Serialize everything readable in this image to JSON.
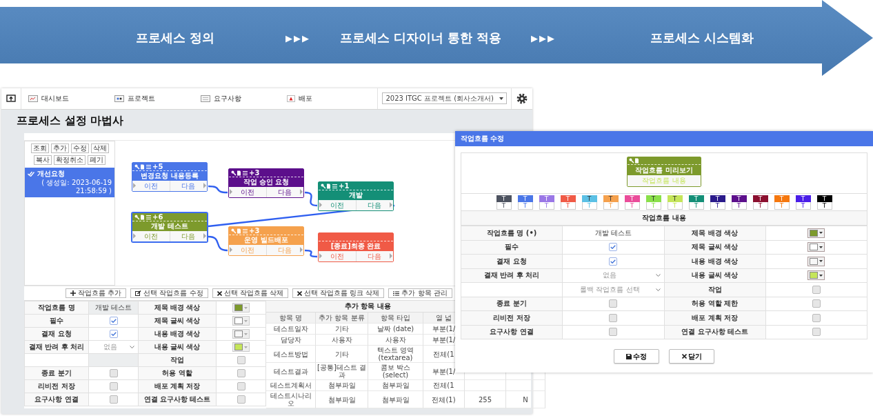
{
  "banner": {
    "items": [
      {
        "kind": "step",
        "text": "프로세스 정의"
      },
      {
        "kind": "separator",
        "text": "▶▶▶"
      },
      {
        "kind": "step",
        "text": "프로세스 디자이너 통한 적용"
      },
      {
        "kind": "separator",
        "text": "▶▶▶"
      },
      {
        "kind": "step",
        "text": "프로세스 시스템화"
      }
    ]
  },
  "app": {
    "nav": [
      {
        "label": "대시보드"
      },
      {
        "label": "프로젝트"
      },
      {
        "label": "요구사항"
      },
      {
        "label": "배포"
      }
    ],
    "project_select": {
      "value": "2023 ITGC 프로젝트 (회사소개서)"
    },
    "title": "프로세스 설정 마법사",
    "list_buttons": [
      "조회",
      "추가",
      "수정",
      "삭제",
      "복사",
      "확정취소",
      "폐기"
    ],
    "process_list": [
      {
        "label": "개선요청",
        "created": "( 생성일: 2023-06-19 21:58:59 )",
        "selected": true
      }
    ],
    "workflow_nodes": [
      {
        "title": "변경요청 내용등록",
        "badge": "+5",
        "color": "#4a76e8",
        "selected": false,
        "prev": "이전",
        "next": "다음"
      },
      {
        "title": "작업 승인 요청",
        "badge": "+3",
        "color": "#5c0f8b",
        "selected": false,
        "prev": "이전",
        "next": "다음"
      },
      {
        "title": "개발",
        "badge": "+1",
        "color": "#148f77",
        "selected": false,
        "prev": "이전",
        "next": "다음"
      },
      {
        "title": "개발 테스트",
        "badge": "+6",
        "color": "#7d9a2c",
        "selected": true,
        "prev": "이전",
        "next": "다음"
      },
      {
        "title": "운영 빌드배포",
        "badge": "+3",
        "color": "#f5a14d",
        "selected": false,
        "prev": "이전",
        "next": "다음"
      },
      {
        "title": "[종료]최종 완료",
        "color": "#f05a46",
        "selected": false,
        "prev": "이전",
        "next": "다음"
      }
    ],
    "actions": [
      {
        "label": "작업흐름 추가"
      },
      {
        "label": "선택 작업흐름 수정"
      },
      {
        "label": "선택 작업흐름 삭제"
      },
      {
        "label": "선택 작업흐름 링크 삭제"
      },
      {
        "label": "추가 항목 관리"
      }
    ],
    "properties": [
      [
        {
          "kind": "label",
          "text": "작업흐름 명"
        },
        {
          "kind": "text",
          "text": "개발 테스트"
        },
        {
          "kind": "label",
          "text": "제목 배경 색상"
        },
        {
          "kind": "color",
          "color": "#7d9a2c"
        }
      ],
      [
        {
          "kind": "label",
          "text": "필수"
        },
        {
          "kind": "check",
          "checked": true
        },
        {
          "kind": "label",
          "text": "제목 글씨 색상"
        },
        {
          "kind": "color",
          "color": "#ffffff"
        }
      ],
      [
        {
          "kind": "label",
          "text": "결재 요청"
        },
        {
          "kind": "check",
          "checked": true
        },
        {
          "kind": "label",
          "text": "내용 배경 색상"
        },
        {
          "kind": "color",
          "color": "#f7f7f7"
        }
      ],
      [
        {
          "kind": "label",
          "text": "결재 반려 후 처리"
        },
        {
          "kind": "select",
          "value": "없음"
        },
        {
          "kind": "label",
          "text": "내용 글씨 색상"
        },
        {
          "kind": "color",
          "color": "#c5e55a"
        }
      ],
      [
        {
          "kind": "blank"
        },
        {
          "kind": "blank-field"
        },
        {
          "kind": "label",
          "text": "작업"
        },
        {
          "kind": "check",
          "checked": false
        }
      ],
      [
        {
          "kind": "label",
          "text": "종료 분기"
        },
        {
          "kind": "check",
          "checked": false
        },
        {
          "kind": "label",
          "text": "허용 역할"
        },
        {
          "kind": "check",
          "checked": false
        }
      ],
      [
        {
          "kind": "label",
          "text": "리비전 저장"
        },
        {
          "kind": "check",
          "checked": false
        },
        {
          "kind": "label",
          "text": "배포 계획 저장"
        },
        {
          "kind": "check",
          "checked": false
        }
      ],
      [
        {
          "kind": "label",
          "text": "요구사항 연결"
        },
        {
          "kind": "check",
          "checked": false
        },
        {
          "kind": "label",
          "text": "연결 요구사항 테스트"
        },
        {
          "kind": "check",
          "checked": false
        }
      ]
    ],
    "extra_items": {
      "title": "추가 항목 내용",
      "columns": [
        "항목 명",
        "추가 항목 분류",
        "항목 타입",
        "열 넓"
      ],
      "rows": [
        [
          "테스트일자",
          "기타",
          "날짜 (date)",
          "부분(1/"
        ],
        [
          "담당자",
          "사용자",
          "사용자",
          "부분(1/"
        ],
        [
          "테스트방법",
          "기타",
          "텍스트 영역 (textarea)",
          "전체(1"
        ],
        [
          "테스트결과",
          "[공통]테스트 결과",
          "콤보 박스(select)",
          "부분(1/"
        ],
        [
          "테스트계획서",
          "첨부파일",
          "첨부파일",
          "전체(1"
        ],
        [
          "테스트시나리오",
          "첨부파일",
          "첨부파일",
          "전체(1)",
          "255",
          "N"
        ]
      ]
    }
  },
  "dialog": {
    "title": "작업흐름 수정",
    "preview": {
      "title": "작업흐름 미리보기",
      "content": "작업흐름 내용"
    },
    "palette": [
      {
        "color": "#4d5360",
        "top": "T",
        "bottom": "T"
      },
      {
        "color": "#4a76e8",
        "top": "T",
        "bottom": "T"
      },
      {
        "color": "#9a77e6",
        "top": "T",
        "bottom": "T"
      },
      {
        "color": "#f05a46",
        "top": "T",
        "bottom": "T"
      },
      {
        "color": "#5bc0e5",
        "top": "T",
        "bottom": "T"
      },
      {
        "color": "#f5a14d",
        "top": "T",
        "bottom": "T"
      },
      {
        "color": "#ea4c9a",
        "top": "T",
        "bottom": "T"
      },
      {
        "color": "#8ae04a",
        "top": "T",
        "bottom": "T"
      },
      {
        "color": "#c5e55a",
        "top": "T",
        "bottom": "T"
      },
      {
        "color": "#148f77",
        "top": "T",
        "bottom": "T"
      },
      {
        "color": "#2a1a8a",
        "top": "T",
        "bottom": "T"
      },
      {
        "color": "#5c0f8b",
        "top": "T",
        "bottom": "T"
      },
      {
        "color": "#8b0f2f",
        "top": "T",
        "bottom": "T"
      },
      {
        "color": "#f5770e",
        "top": "T",
        "bottom": "T"
      },
      {
        "color": "#4a1ee8",
        "top": "T",
        "bottom": "T"
      },
      {
        "color": "#000000",
        "top": "T",
        "bottom": "T"
      }
    ],
    "section": "작업흐름 내용",
    "properties": [
      [
        {
          "kind": "label",
          "text": "작업흐름 명 (•)"
        },
        {
          "kind": "text",
          "text": "개발 테스트"
        },
        {
          "kind": "label",
          "text": "제목 배경 색상"
        },
        {
          "kind": "color",
          "color": "#7d9a2c"
        }
      ],
      [
        {
          "kind": "label",
          "text": "필수"
        },
        {
          "kind": "check",
          "checked": true
        },
        {
          "kind": "label",
          "text": "제목 글씨 색상"
        },
        {
          "kind": "color",
          "color": "#ffffff"
        }
      ],
      [
        {
          "kind": "label",
          "text": "결재 요청"
        },
        {
          "kind": "check",
          "checked": true
        },
        {
          "kind": "label",
          "text": "내용 배경 색상"
        },
        {
          "kind": "color",
          "color": "#f7f7f7"
        }
      ],
      [
        {
          "kind": "label",
          "text": "결재 반려 후 처리"
        },
        {
          "kind": "select",
          "value": "없음"
        },
        {
          "kind": "label",
          "text": "내용 글씨 색상"
        },
        {
          "kind": "color",
          "color": "#c5e55a"
        }
      ],
      [
        {
          "kind": "blank"
        },
        {
          "kind": "select",
          "placeholder": "롤백 작업흐름 선택"
        },
        {
          "kind": "label",
          "text": "작업"
        },
        {
          "kind": "check",
          "checked": false
        }
      ],
      [
        {
          "kind": "label",
          "text": "종료 분기"
        },
        {
          "kind": "check",
          "checked": false
        },
        {
          "kind": "label",
          "text": "허용 역할 제한"
        },
        {
          "kind": "check",
          "checked": false
        }
      ],
      [
        {
          "kind": "label",
          "text": "리비전 저장"
        },
        {
          "kind": "check",
          "checked": false
        },
        {
          "kind": "label",
          "text": "배포 계획 저장"
        },
        {
          "kind": "check",
          "checked": false
        }
      ],
      [
        {
          "kind": "label",
          "text": "요구사항 연결"
        },
        {
          "kind": "check",
          "checked": false
        },
        {
          "kind": "label",
          "text": "연결 요구사항 테스트"
        },
        {
          "kind": "check",
          "checked": false
        }
      ]
    ],
    "buttons": [
      {
        "label": "수정"
      },
      {
        "label": "닫기"
      }
    ]
  }
}
